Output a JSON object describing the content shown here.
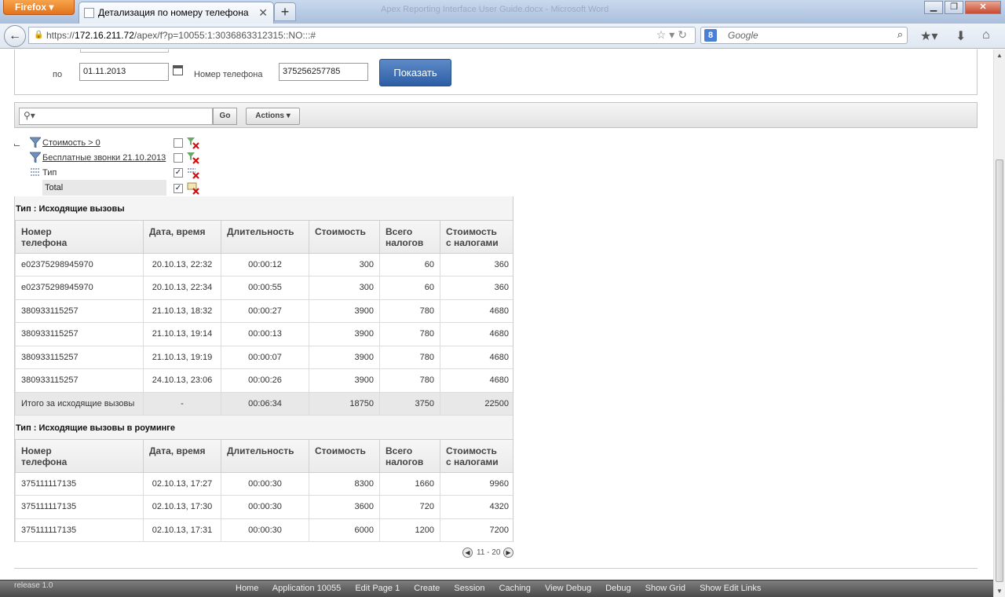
{
  "browser": {
    "menu_label": "Firefox",
    "tab_title": "Детализация по номеру телефона",
    "background_title": "Apex Reporting Interface User Guide.docx - Microsoft Word",
    "url_prefix": "https://",
    "url_host": "172.16.211.72",
    "url_path": "/apex/f?p=10055:1:3036863312315::NO:::#",
    "search_engine_label": "8",
    "search_placeholder": "Google"
  },
  "form": {
    "to_label": "по",
    "to_date": "01.11.2013",
    "phone_label": "Номер телефона",
    "phone_value": "375256257785",
    "show_button": "Показать"
  },
  "toolbar": {
    "go_label": "Go",
    "actions_label": "Actions ▾"
  },
  "filters": [
    {
      "label": "Стоимость > 0",
      "checked": false,
      "icon": "filter-icon"
    },
    {
      "label": "Бесплатные звонки 21.10.2013",
      "checked": false,
      "icon": "filter-icon"
    },
    {
      "label": "Тип",
      "checked": true,
      "icon": "control-break-icon"
    },
    {
      "label": "Total",
      "checked": true,
      "icon": "aggregate-icon"
    }
  ],
  "report": {
    "columns": [
      "Номер\nтелефона",
      "Дата, время",
      "Длительность",
      "Стоимость",
      "Всего\nналогов",
      "Стоимость\nс налогами"
    ],
    "groups": [
      {
        "title": "Тип : Исходящие вызовы",
        "rows": [
          [
            "e02375298945970",
            "20.10.13, 22:32",
            "00:00:12",
            "300",
            "60",
            "360"
          ],
          [
            "e02375298945970",
            "20.10.13, 22:34",
            "00:00:55",
            "300",
            "60",
            "360"
          ],
          [
            "380933115257",
            "21.10.13, 18:32",
            "00:00:27",
            "3900",
            "780",
            "4680"
          ],
          [
            "380933115257",
            "21.10.13, 19:14",
            "00:00:13",
            "3900",
            "780",
            "4680"
          ],
          [
            "380933115257",
            "21.10.13, 19:19",
            "00:00:07",
            "3900",
            "780",
            "4680"
          ],
          [
            "380933115257",
            "24.10.13, 23:06",
            "00:00:26",
            "3900",
            "780",
            "4680"
          ]
        ],
        "total": [
          "Итого за исходящие вызовы",
          "-",
          "00:06:34",
          "18750",
          "3750",
          "22500"
        ]
      },
      {
        "title": "Тип : Исходящие вызовы в роуминге",
        "rows": [
          [
            "375111117135",
            "02.10.13, 17:27",
            "00:00:30",
            "8300",
            "1660",
            "9960"
          ],
          [
            "375111117135",
            "02.10.13, 17:30",
            "00:00:30",
            "3600",
            "720",
            "4320"
          ],
          [
            "375111117135",
            "02.10.13, 17:31",
            "00:00:30",
            "6000",
            "1200",
            "7200"
          ]
        ]
      }
    ],
    "pagination": "11 - 20"
  },
  "footer": {
    "release": "release 1.0",
    "links": [
      "Home",
      "Application 10055",
      "Edit Page 1",
      "Create",
      "Session",
      "Caching",
      "View Debug",
      "Debug",
      "Show Grid",
      "Show Edit Links"
    ]
  }
}
